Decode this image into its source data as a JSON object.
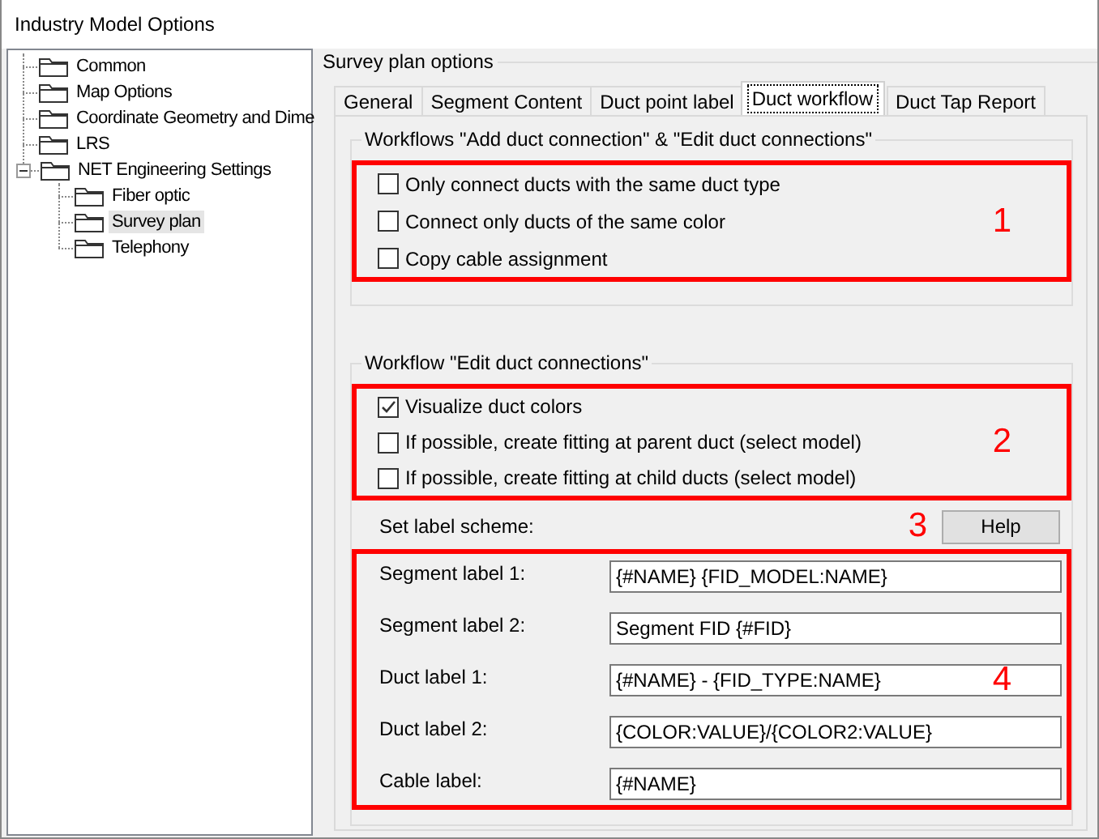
{
  "window": {
    "title": "Industry Model Options"
  },
  "tree": [
    {
      "label": "Common",
      "selected": false
    },
    {
      "label": "Map Options",
      "selected": false
    },
    {
      "label": "Coordinate Geometry and Dime",
      "selected": false
    },
    {
      "label": "LRS",
      "selected": false
    },
    {
      "label": "NET Engineering Settings",
      "selected": false,
      "expanded": true,
      "children": [
        {
          "label": "Fiber optic",
          "selected": false
        },
        {
          "label": "Survey plan",
          "selected": true
        },
        {
          "label": "Telephony",
          "selected": false
        }
      ]
    }
  ],
  "panel": {
    "title": "Survey plan options"
  },
  "tabs": [
    {
      "label": "General",
      "selected": false
    },
    {
      "label": "Segment Content",
      "selected": false
    },
    {
      "label": "Duct point label",
      "selected": false
    },
    {
      "label": "Duct workflow",
      "selected": true
    },
    {
      "label": "Duct Tap Report",
      "selected": false
    }
  ],
  "groups": [
    {
      "title": "Workflows \"Add duct connection\" & \"Edit duct connections\"",
      "annotation": "1",
      "checkboxes": [
        {
          "label": "Only connect ducts with the same duct type",
          "checked": false
        },
        {
          "label": "Connect only ducts of the same color",
          "checked": false
        },
        {
          "label": "Copy cable assignment",
          "checked": false
        }
      ]
    },
    {
      "title": "Workflow \"Edit duct connections\"",
      "annotation": "2",
      "checkboxes": [
        {
          "label": "Visualize duct colors",
          "checked": true
        },
        {
          "label": "If possible, create fitting at parent duct (select model)",
          "checked": false
        },
        {
          "label": "If possible, create fitting at child ducts (select model)",
          "checked": false
        }
      ],
      "label_scheme": {
        "label": "Set label scheme:",
        "annotation": "3",
        "help_button": "Help",
        "fields_annotation": "4",
        "fields": [
          {
            "label": "Segment label 1:",
            "value": "{#NAME} {FID_MODEL:NAME}"
          },
          {
            "label": "Segment label 2:",
            "value": "Segment FID {#FID}"
          },
          {
            "label": "Duct label 1:",
            "value": "{#NAME} - {FID_TYPE:NAME}"
          },
          {
            "label": "Duct label 2:",
            "value": "{COLOR:VALUE}/{COLOR2:VALUE}"
          },
          {
            "label": "Cable label:",
            "value": "{#NAME}"
          }
        ]
      }
    }
  ]
}
